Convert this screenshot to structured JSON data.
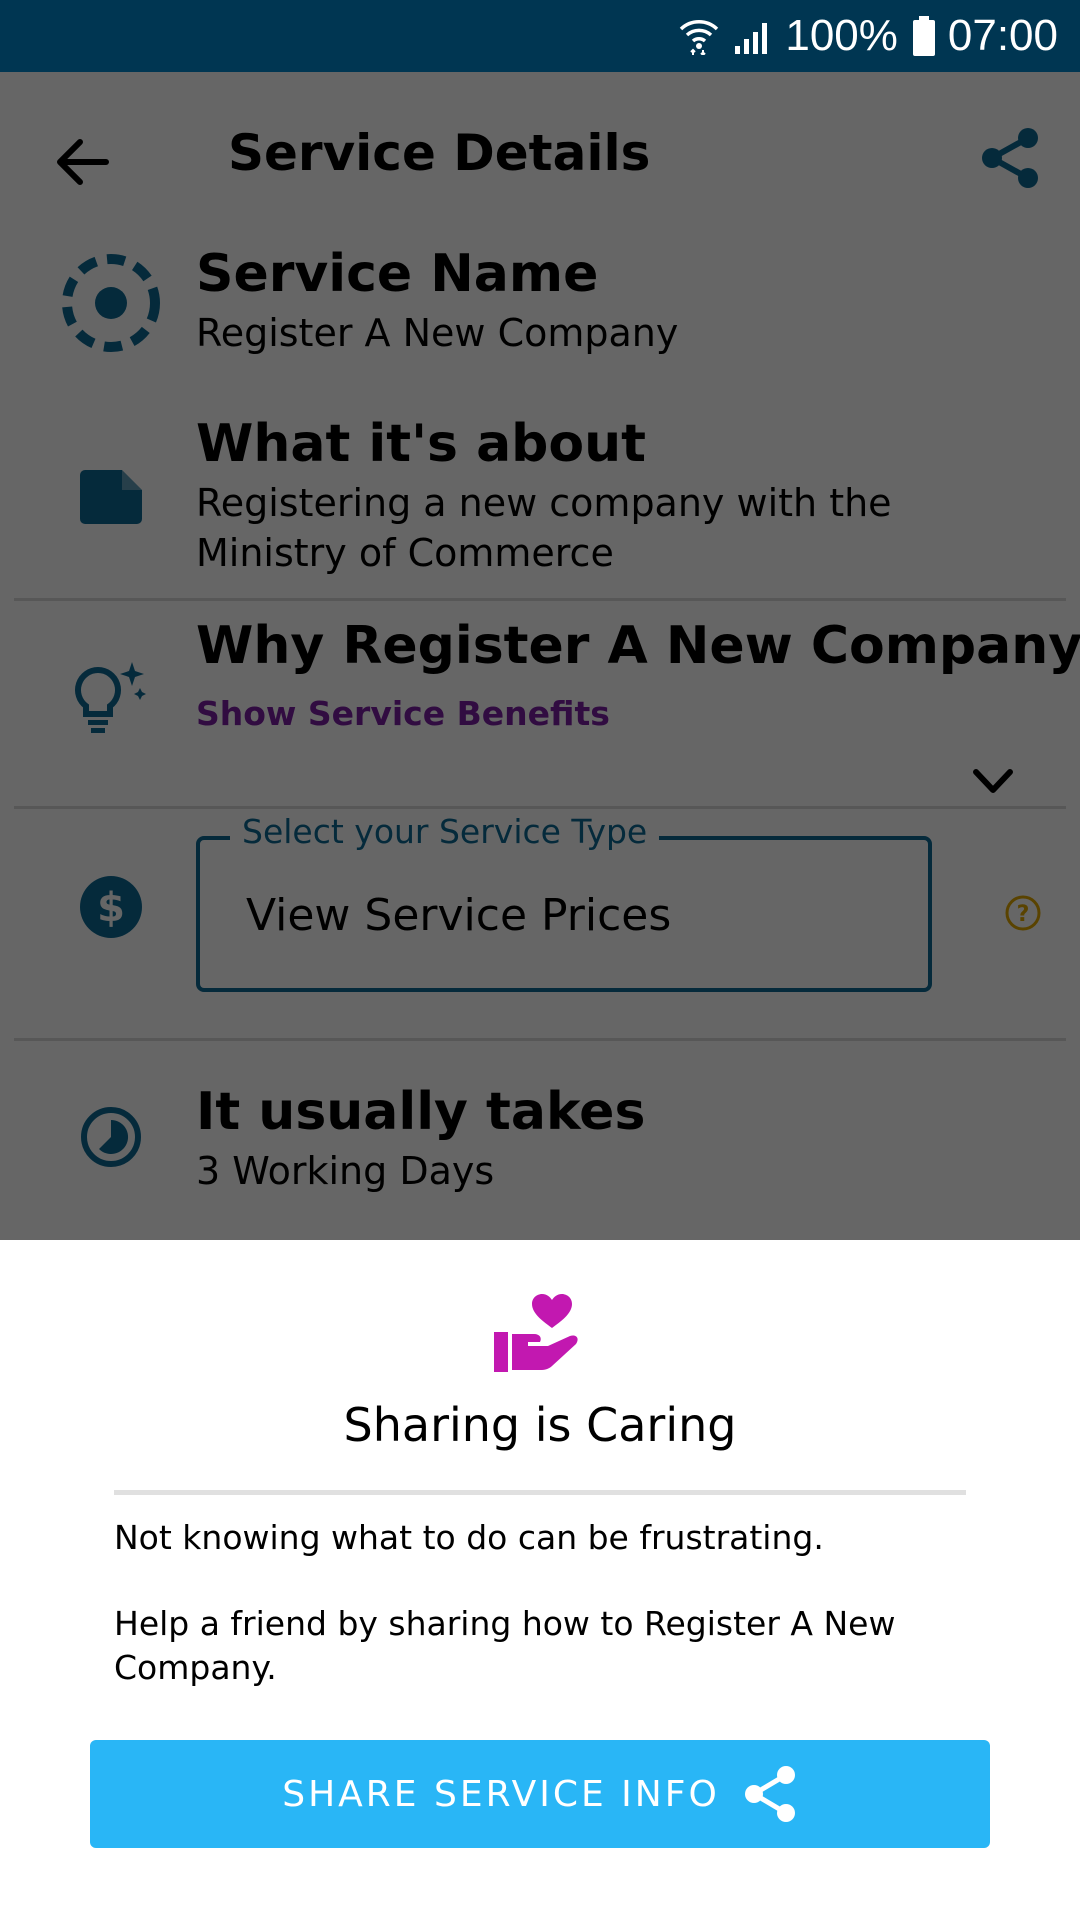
{
  "status_bar": {
    "battery": "100%",
    "time": "07:00"
  },
  "app_bar": {
    "title": "Service Details"
  },
  "service_name": {
    "heading": "Service Name",
    "value": "Register A New Company"
  },
  "about": {
    "heading": "What it's about",
    "value": "Registering a new company with the Ministry of Commerce"
  },
  "why": {
    "heading": "Why Register A New Company",
    "link": "Show Service Benefits"
  },
  "service_type": {
    "label": "Select your Service Type",
    "value": "View Service Prices"
  },
  "duration": {
    "heading": "It usually takes",
    "value": "3 Working Days"
  },
  "sheet": {
    "title": "Sharing is Caring",
    "body1": "Not knowing what to do can be frustrating.",
    "body2": "Help a friend by sharing how to Register A New Company.",
    "button": "SHARE SERVICE INFO"
  },
  "colors": {
    "status_bar": "#003652",
    "accent_blue": "#0d6a94",
    "link_purple": "#7b1fa2",
    "heart_magenta": "#c218b0",
    "button_blue": "#29b6f6"
  },
  "icons": [
    "wifi-icon",
    "signal-icon",
    "battery-icon",
    "back-arrow-icon",
    "share-icon",
    "target-icon",
    "document-icon",
    "lightbulb-icon",
    "chevron-down-icon",
    "dollar-icon",
    "help-icon",
    "clock-icon",
    "heart-hand-icon"
  ]
}
